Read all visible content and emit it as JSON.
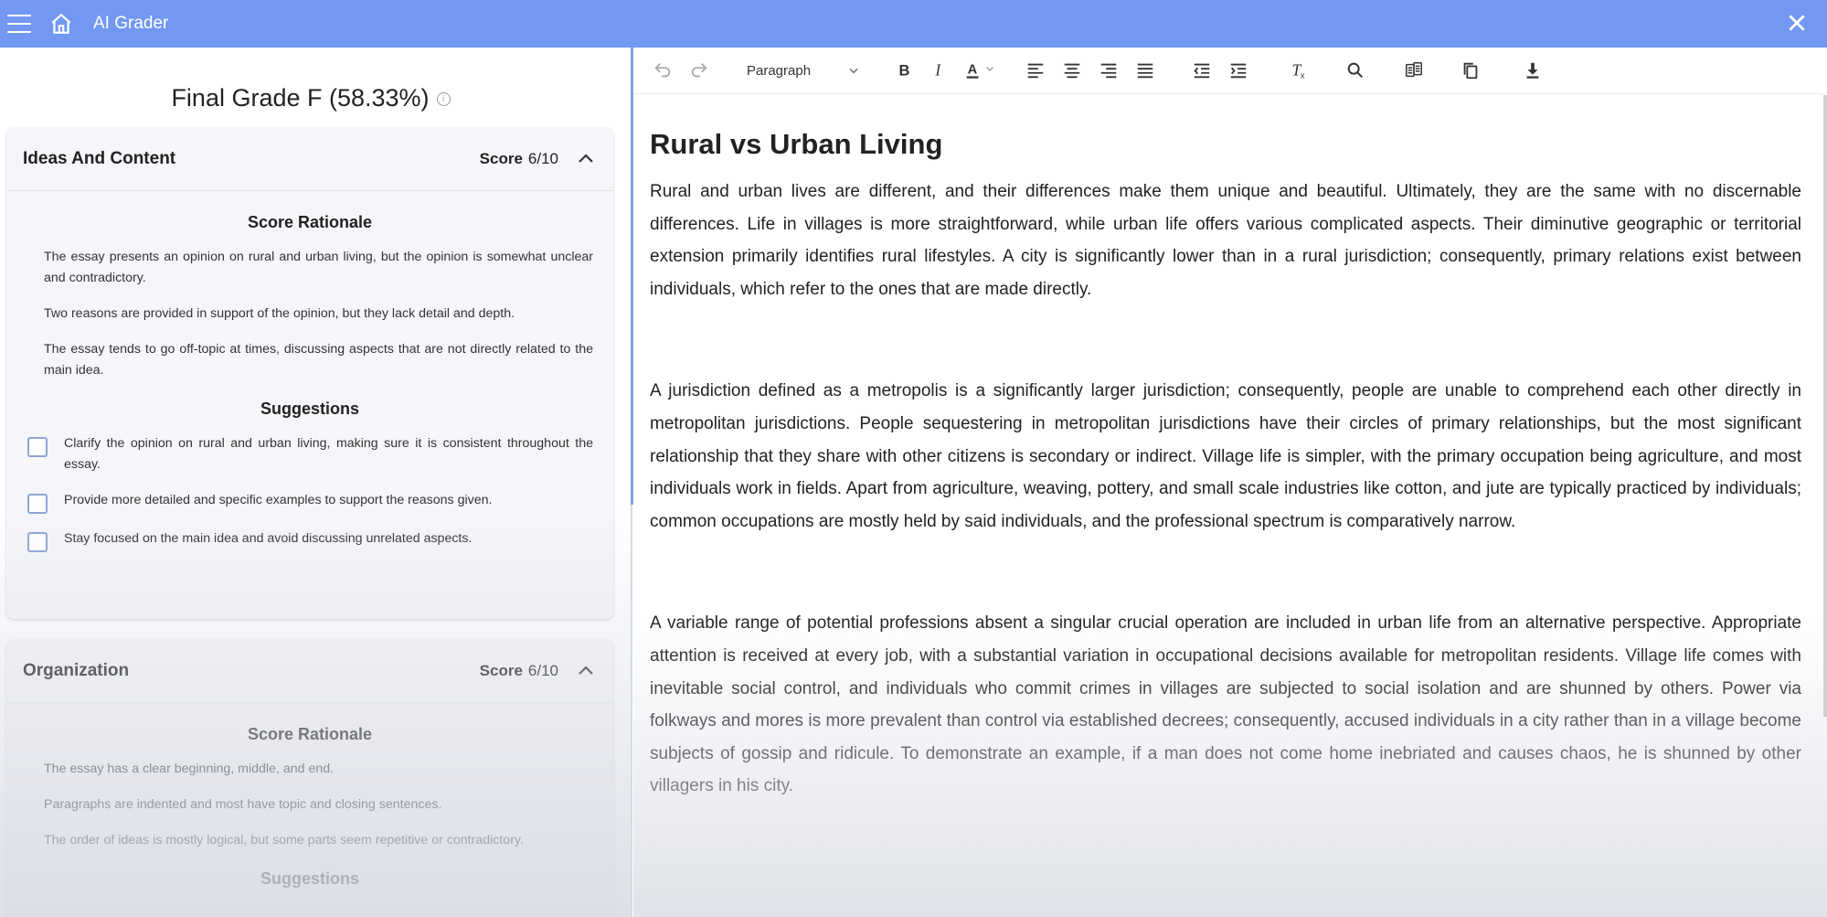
{
  "app": {
    "title": "AI Grader"
  },
  "grade": {
    "label": "Final Grade F (58.33%)",
    "info_icon": "info-icon"
  },
  "cards": [
    {
      "title": "Ideas And Content",
      "score_label": "Score",
      "score_value": "6/10",
      "rationale_title": "Score Rationale",
      "rationale": [
        "The essay presents an opinion on rural and urban living, but the opinion is somewhat unclear and contradictory.",
        "Two reasons are provided in support of the opinion, but they lack detail and depth.",
        "The essay tends to go off-topic at times, discussing aspects that are not directly related to the main idea."
      ],
      "suggestions_title": "Suggestions",
      "suggestions": [
        "Clarify the opinion on rural and urban living, making sure it is consistent throughout the essay.",
        "Provide more detailed and specific examples to support the reasons given.",
        "Stay focused on the main idea and avoid discussing unrelated aspects."
      ]
    },
    {
      "title": "Organization",
      "score_label": "Score",
      "score_value": "6/10",
      "rationale_title": "Score Rationale",
      "rationale": [
        "The essay has a clear beginning, middle, and end.",
        "Paragraphs are indented and most have topic and closing sentences.",
        "The order of ideas is mostly logical, but some parts seem repetitive or contradictory."
      ],
      "suggestions_title": "Suggestions"
    }
  ],
  "toolbar": {
    "paragraph_style": "Paragraph"
  },
  "document": {
    "title": "Rural vs Urban Living",
    "paragraphs": [
      "Rural and urban lives are different, and their differences make them unique and beautiful. Ultimately, they are the same with no discernable differences. Life in villages is more straightforward, while urban life offers various complicated aspects. Their diminutive geographic or territorial extension primarily identifies rural lifestyles. A city is significantly lower than in a rural jurisdiction; consequently, primary relations exist between individuals, which refer to the ones that are made directly.",
      "A jurisdiction defined as a metropolis is a significantly larger jurisdiction; consequently, people are unable to comprehend each other directly in metropolitan jurisdictions. People sequestering in metropolitan jurisdictions have their circles of primary relationships, but the most significant relationship that they share with other citizens is secondary or indirect. Village life is simpler, with the primary occupation being agriculture, and most individuals work in fields. Apart from agriculture, weaving, pottery, and small scale industries like cotton, and jute are typically practiced by individuals; common occupations are mostly held by said individuals, and the professional spectrum is comparatively narrow.",
      "A variable range of potential professions absent a singular crucial operation are included in urban life from an alternative perspective. Appropriate attention is received at every job, with a substantial variation in occupational decisions available for metropolitan residents. Village life comes with inevitable social control, and individuals who commit crimes in villages are subjected to social isolation and are shunned by others. Power via folkways and mores is more prevalent than control via established decrees; consequently, accused individuals in a city rather than in a village become subjects of gossip and ridicule. To demonstrate an example, if a man does not come home inebriated and causes chaos, he is shunned by other villagers in his city."
    ]
  }
}
